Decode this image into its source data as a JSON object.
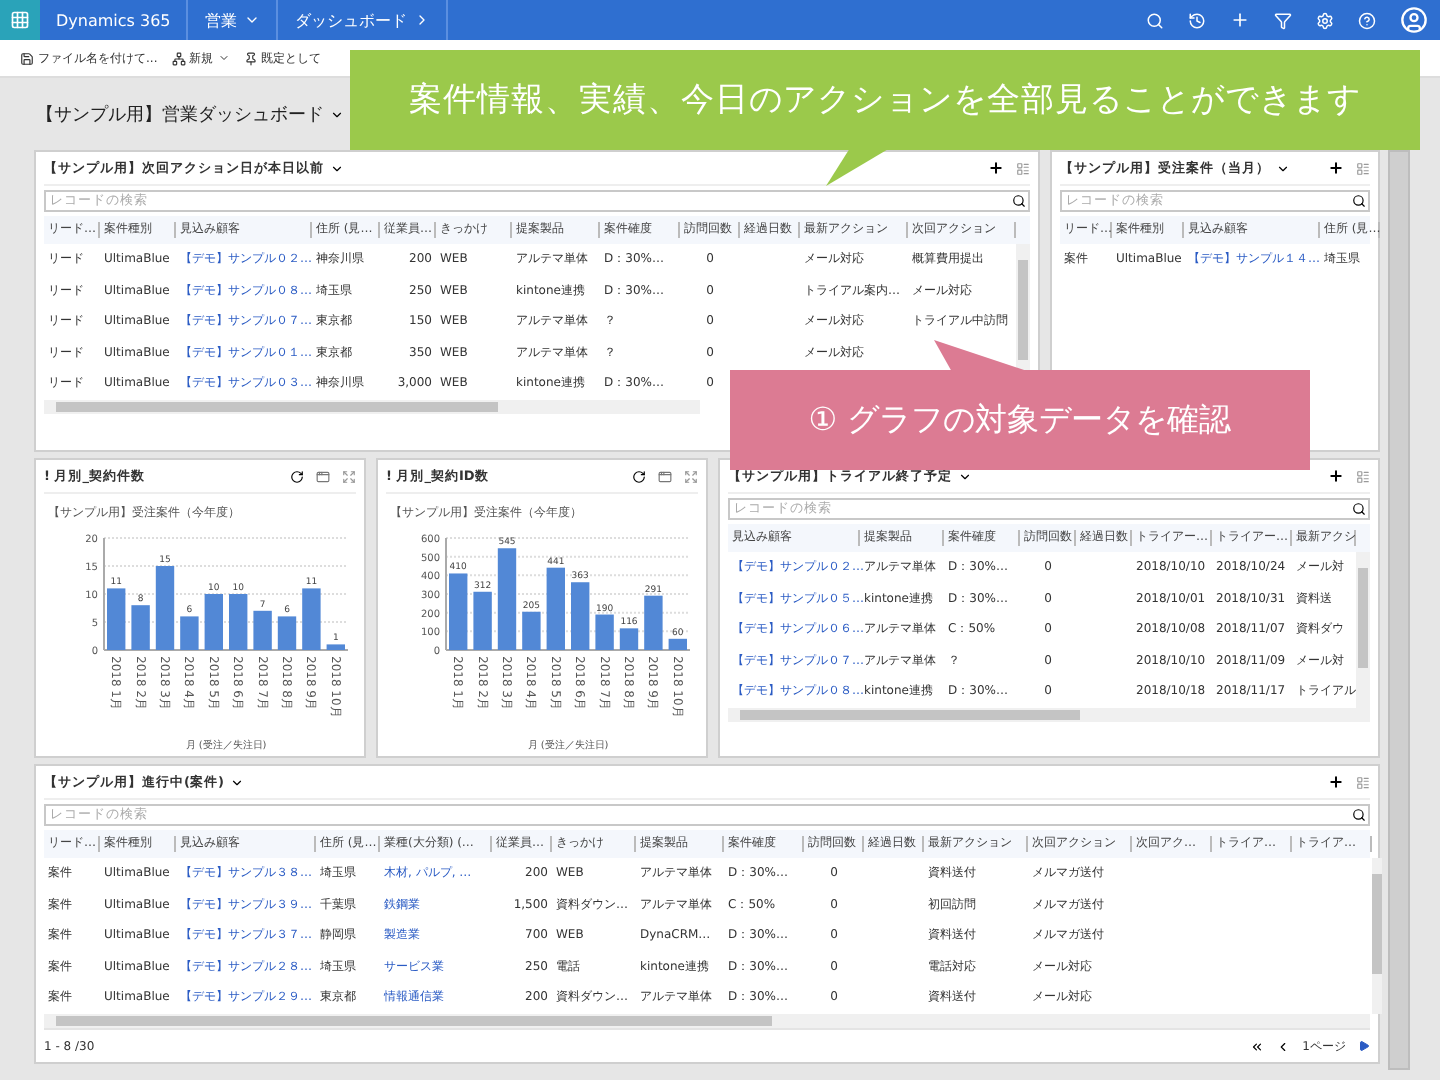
{
  "nav": {
    "app_name": "Dynamics 365",
    "area": "営業",
    "breadcrumb": "ダッシュボード"
  },
  "commands": [
    "ファイル名を付けて...",
    "新規",
    "既定として"
  ],
  "dashboard_title": "【サンプル用】営業ダッシュボード",
  "callouts": [
    {
      "kind": "green",
      "text": "案件情報、実績、今日のアクションを全部見ることができます"
    },
    {
      "kind": "pink",
      "text": "① グラフの対象データを確認"
    }
  ],
  "grids": [
    {
      "title": "【サンプル用】次回アクション日が本日以前",
      "placeholder": "レコードの検索",
      "columns": [
        {
          "label": "リード…",
          "kind": "text"
        },
        {
          "label": "案件種別",
          "kind": "text"
        },
        {
          "label": "見込み顧客",
          "kind": "link"
        },
        {
          "label": "住所 (見…",
          "kind": "text"
        },
        {
          "label": "従業員…",
          "kind": "text"
        },
        {
          "label": "きっかけ",
          "kind": "text"
        },
        {
          "label": "提案製品",
          "kind": "text"
        },
        {
          "label": "案件確度",
          "kind": "text"
        },
        {
          "label": "訪問回数",
          "kind": "text"
        },
        {
          "label": "経過日数",
          "kind": "text"
        },
        {
          "label": "最新アクション",
          "kind": "text"
        },
        {
          "label": "次回アクション",
          "kind": "text"
        }
      ],
      "rows": [
        [
          "リード",
          "UltimaBlue",
          "【デモ】サンプル０２…",
          "神奈川県",
          "200",
          "WEB",
          "アルテマ単体",
          "D：30%…",
          "0",
          null,
          "メール対応",
          "概算費用提出"
        ],
        [
          "リード",
          "UltimaBlue",
          "【デモ】サンプル０８…",
          "埼玉県",
          "250",
          "WEB",
          "kintone連携",
          "D：30%…",
          "0",
          null,
          "トライアル案内…",
          "メール対応"
        ],
        [
          "リード",
          "UltimaBlue",
          "【デモ】サンプル０７…",
          "東京都",
          "150",
          "WEB",
          "アルテマ単体",
          "？",
          "0",
          null,
          "メール対応",
          "トライアル中訪問"
        ],
        [
          "リード",
          "UltimaBlue",
          "【デモ】サンプル０１…",
          "東京都",
          "350",
          "WEB",
          "アルテマ単体",
          "？",
          "0",
          null,
          "メール対応",
          null
        ],
        [
          "リード",
          "UltimaBlue",
          "【デモ】サンプル０３…",
          "神奈川県",
          "3,000",
          "WEB",
          "kintone連携",
          "D：30%…",
          "0",
          null,
          null,
          null
        ]
      ]
    },
    {
      "title": "【サンプル用】受注案件（当月）",
      "placeholder": "レコードの検索",
      "columns": [
        {
          "label": "リード…",
          "kind": "text"
        },
        {
          "label": "案件種別",
          "kind": "text"
        },
        {
          "label": "見込み顧客",
          "kind": "link"
        },
        {
          "label": "住所 (見…",
          "kind": "text"
        }
      ],
      "rows": [
        [
          "案件",
          "UltimaBlue",
          "【デモ】サンプル１４…",
          "埼玉県"
        ]
      ]
    },
    {
      "title": "【サンプル用】トライアル終了予定",
      "placeholder": "レコードの検索",
      "columns": [
        {
          "label": "見込み顧客",
          "kind": "link"
        },
        {
          "label": "提案製品",
          "kind": "text"
        },
        {
          "label": "案件確度",
          "kind": "text"
        },
        {
          "label": "訪問回数",
          "kind": "text"
        },
        {
          "label": "経過日数",
          "kind": "text"
        },
        {
          "label": "トライアー…",
          "kind": "text"
        },
        {
          "label": "トライアー…",
          "kind": "text"
        },
        {
          "label": "最新アクシ",
          "kind": "text"
        }
      ],
      "rows": [
        [
          "【デモ】サンプル０２…",
          "アルテマ単体",
          "D：30%…",
          "0",
          null,
          "2018/10/10",
          "2018/10/24",
          "メール対"
        ],
        [
          "【デモ】サンプル０５…",
          "kintone連携",
          "D：30%…",
          "0",
          null,
          "2018/10/01",
          "2018/10/31",
          "資料送"
        ],
        [
          "【デモ】サンプル０６…",
          "アルテマ単体",
          "C：50%",
          "0",
          null,
          "2018/10/08",
          "2018/11/07",
          "資料ダウ"
        ],
        [
          "【デモ】サンプル０７…",
          "アルテマ単体",
          "？",
          "0",
          null,
          "2018/10/10",
          "2018/11/09",
          "メール対"
        ],
        [
          "【デモ】サンプル０８…",
          "kintone連携",
          "D：30%…",
          "0",
          null,
          "2018/10/18",
          "2018/11/17",
          "トライアル"
        ]
      ]
    },
    {
      "title": "【サンプル用】進行中(案件)",
      "placeholder": "レコードの検索",
      "footer": "1 - 8 /30",
      "page": "1ページ",
      "columns": [
        {
          "label": "リード…",
          "kind": "text"
        },
        {
          "label": "案件種別",
          "kind": "text"
        },
        {
          "label": "見込み顧客",
          "kind": "link"
        },
        {
          "label": "住所 (見…",
          "kind": "text"
        },
        {
          "label": "業種(大分類) (…",
          "kind": "link"
        },
        {
          "label": "従業員…",
          "kind": "text"
        },
        {
          "label": "きっかけ",
          "kind": "text"
        },
        {
          "label": "提案製品",
          "kind": "text"
        },
        {
          "label": "案件確度",
          "kind": "text"
        },
        {
          "label": "訪問回数",
          "kind": "text"
        },
        {
          "label": "経過日数",
          "kind": "text"
        },
        {
          "label": "最新アクション",
          "kind": "text"
        },
        {
          "label": "次回アクション",
          "kind": "text"
        },
        {
          "label": "次回アク…",
          "kind": "text"
        },
        {
          "label": "トライア…",
          "kind": "text"
        },
        {
          "label": "トライア…",
          "kind": "text"
        }
      ],
      "rows": [
        [
          "案件",
          "UltimaBlue",
          "【デモ】サンプル３８…",
          "埼玉県",
          "木材, パルプ, …",
          "200",
          "WEB",
          "アルテマ単体",
          "D：30%…",
          "0",
          null,
          "資料送付",
          "メルマガ送付",
          null,
          null,
          null
        ],
        [
          "案件",
          "UltimaBlue",
          "【デモ】サンプル３９…",
          "千葉県",
          "鉄鋼業",
          "1,500",
          "資料ダウン…",
          "アルテマ単体",
          "C：50%",
          "0",
          null,
          "初回訪問",
          "メルマガ送付",
          null,
          null,
          null
        ],
        [
          "案件",
          "UltimaBlue",
          "【デモ】サンプル３７…",
          "静岡県",
          "製造業",
          "700",
          "WEB",
          "DynaCRM…",
          "D：30%…",
          "0",
          null,
          "資料送付",
          "メルマガ送付",
          null,
          null,
          null
        ],
        [
          "案件",
          "UltimaBlue",
          "【デモ】サンプル２８…",
          "埼玉県",
          "サービス業",
          "250",
          "電話",
          "kintone連携",
          "D：30%…",
          "0",
          null,
          "電話対応",
          "メール対応",
          null,
          null,
          null
        ],
        [
          "案件",
          "UltimaBlue",
          "【デモ】サンプル２９…",
          "東京都",
          "情報通信業",
          "200",
          "資料ダウン…",
          "アルテマ単体",
          "D：30%…",
          "0",
          null,
          "資料送付",
          "メール対応",
          null,
          null,
          null
        ]
      ]
    }
  ],
  "charts": [
    {
      "title": "! 月別_契約件数",
      "subtitle": "【サンプル用】受注案件（今年度）",
      "chart_data": {
        "type": "bar",
        "xlabel": "月 (受注／失注日)",
        "categories": [
          "2018 1月",
          "2018 2月",
          "2018 3月",
          "2018 4月",
          "2018 5月",
          "2018 6月",
          "2018 7月",
          "2018 8月",
          "2018 9月",
          "2018 10月"
        ],
        "values": [
          11,
          8,
          15,
          6,
          10,
          10,
          7,
          6,
          11,
          1
        ],
        "ylim": [
          0,
          20
        ],
        "grid": true,
        "yticks": [
          0,
          5,
          10,
          15,
          20
        ],
        "data_labels": true
      }
    },
    {
      "title": "! 月別_契約ID数",
      "subtitle": "【サンプル用】受注案件（今年度）",
      "chart_data": {
        "type": "bar",
        "xlabel": "月 (受注／失注日)",
        "categories": [
          "2018 1月",
          "2018 2月",
          "2018 3月",
          "2018 4月",
          "2018 5月",
          "2018 6月",
          "2018 7月",
          "2018 8月",
          "2018 9月",
          "2018 10月"
        ],
        "values": [
          410,
          312,
          545,
          205,
          441,
          363,
          190,
          116,
          291,
          60
        ],
        "ylim": [
          0,
          600
        ],
        "grid": true,
        "yticks": [
          0,
          100,
          200,
          300,
          400,
          500,
          600
        ],
        "data_labels": true
      }
    }
  ]
}
